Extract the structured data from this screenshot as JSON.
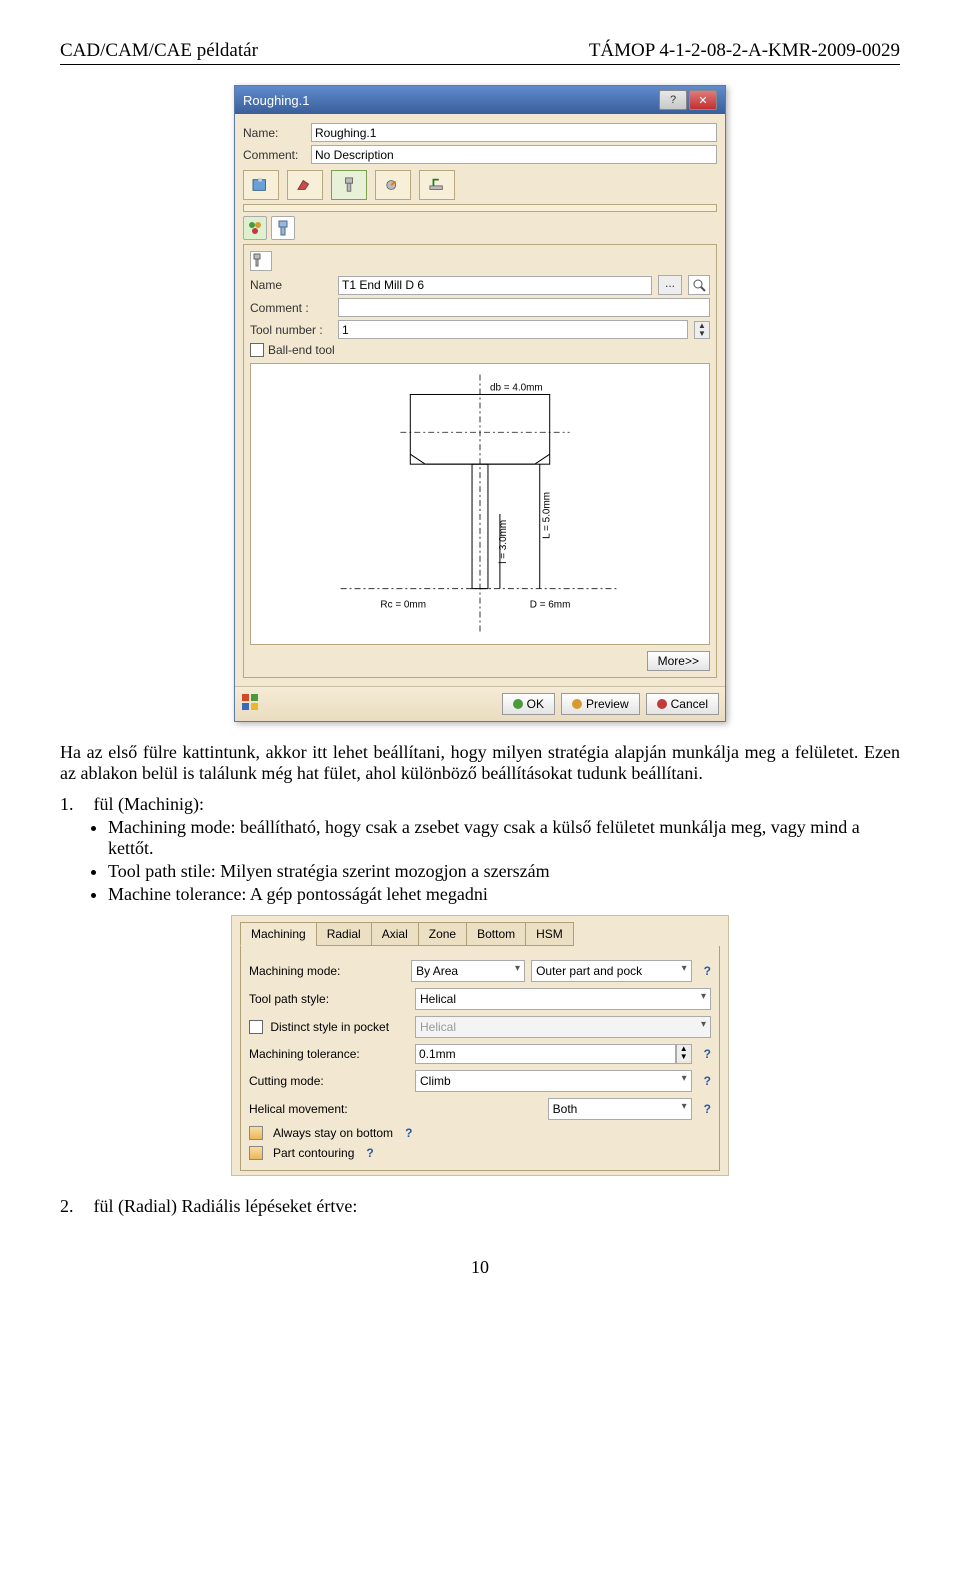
{
  "header": {
    "left": "CAD/CAM/CAE példatár",
    "right": "TÁMOP 4-1-2-08-2-A-KMR-2009-0029"
  },
  "dialog1": {
    "title": "Roughing.1",
    "name_label": "Name:",
    "name_value": "Roughing.1",
    "comment_label": "Comment:",
    "comment_value": "No Description",
    "inner": {
      "name_label": "Name",
      "name_value": "T1 End Mill D 6",
      "comment_label": "Comment :",
      "comment_value": "",
      "toolnum_label": "Tool number :",
      "toolnum_value": "1",
      "ballend_label": "Ball-end tool"
    },
    "canvas": {
      "db": "db = 4.0mm",
      "l": "l = 3.0mm",
      "L": "L = 5.0mm",
      "Rc": "Rc = 0mm",
      "D": "D = 6mm"
    },
    "more": "More>>",
    "buttons": {
      "ok": "OK",
      "preview": "Preview",
      "cancel": "Cancel"
    }
  },
  "para1": "Ha az első fülre kattintunk, akkor itt lehet beállítani, hogy milyen stratégia alapján munkálja meg a felületet. Ezen az ablakon belül is találunk még hat fület, ahol különböző beállításokat tudunk beállítani.",
  "list1_num": "1.",
  "list1_label": "fül (Machinig):",
  "bullets": {
    "b1": "Machining mode: beállítható, hogy csak a zsebet vagy csak a külső felületet munkálja meg, vagy mind a kettőt.",
    "b2": "Tool path stile: Milyen stratégia szerint mozogjon a szerszám",
    "b3": "Machine tolerance: A gép pontosságát lehet megadni"
  },
  "dialog2": {
    "tabs": [
      "Machining",
      "Radial",
      "Axial",
      "Zone",
      "Bottom",
      "HSM"
    ],
    "rows": {
      "mode_label": "Machining mode:",
      "mode_val1": "By Area",
      "mode_val2": "Outer part and pock",
      "style_label": "Tool path style:",
      "style_val": "Helical",
      "distinct_label": "Distinct style in pocket",
      "distinct_val": "Helical",
      "tol_label": "Machining tolerance:",
      "tol_val": "0.1mm",
      "cut_label": "Cutting mode:",
      "cut_val": "Climb",
      "helical_label": "Helical movement:",
      "helical_val": "Both",
      "stay_label": "Always stay on bottom",
      "part_label": "Part contouring"
    }
  },
  "list2_num": "2.",
  "list2_label": "fül (Radial) Radiális lépéseket értve:",
  "page_number": "10"
}
